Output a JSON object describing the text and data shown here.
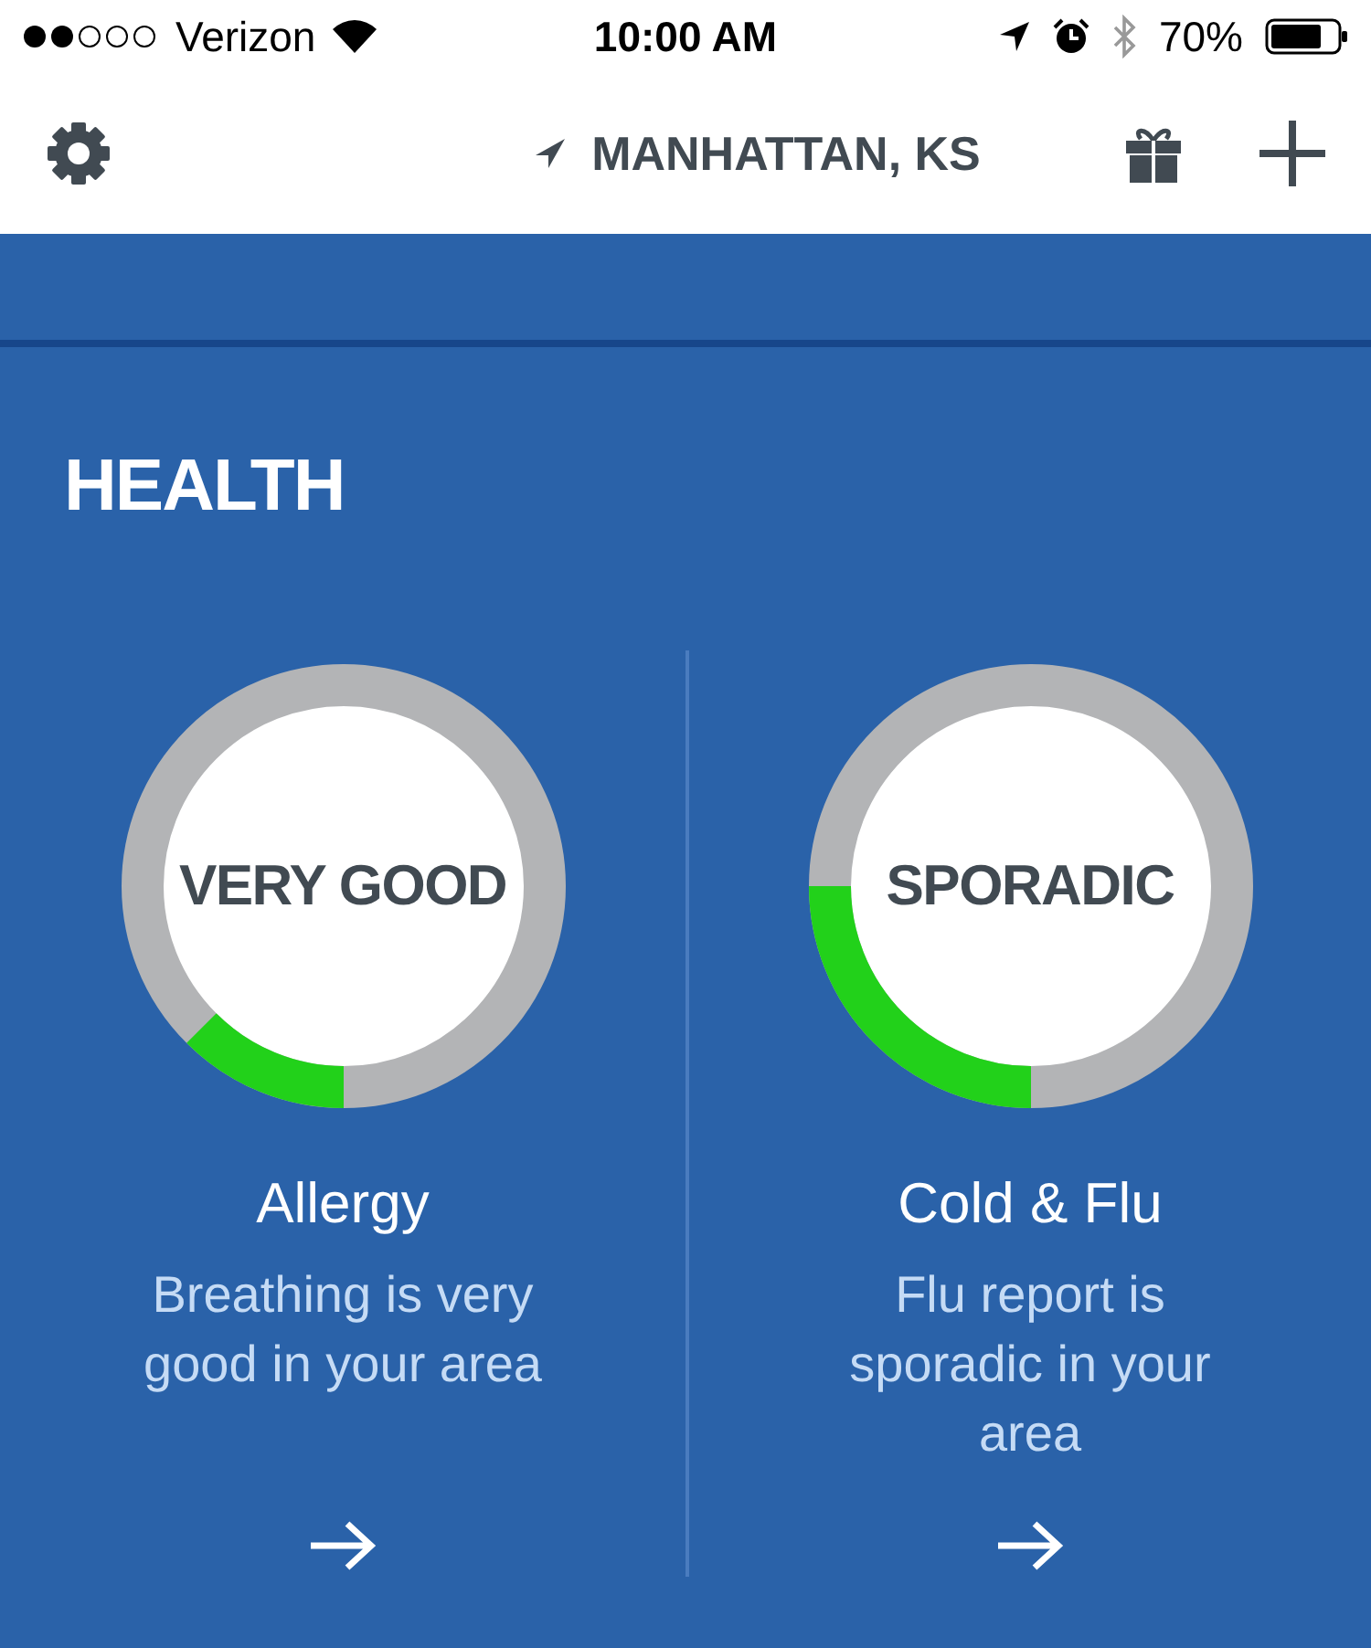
{
  "status_bar": {
    "carrier": "Verizon",
    "time": "10:00 AM",
    "battery": "70%"
  },
  "header": {
    "location": "MANHATTAN, KS"
  },
  "section": {
    "title": "HEALTH"
  },
  "cards": [
    {
      "rating": "VERY GOOD",
      "title": "Allergy",
      "description": "Breathing is very good in your area"
    },
    {
      "rating": "SPORADIC",
      "title": "Cold & Flu",
      "description": "Flu report is sporadic in your area"
    }
  ]
}
